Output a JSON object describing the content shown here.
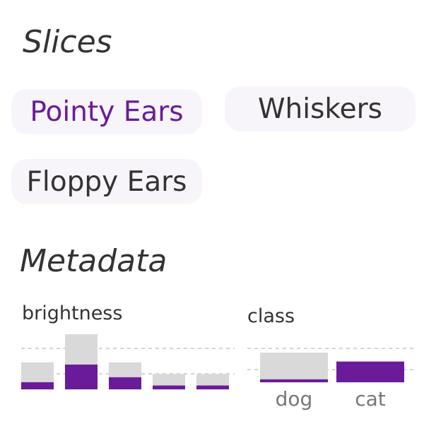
{
  "slices": {
    "title": "Slices",
    "chips": [
      {
        "label": "Pointy Ears",
        "selected": true
      },
      {
        "label": "Whiskers",
        "selected": false
      },
      {
        "label": "Floppy Ears",
        "selected": false
      }
    ]
  },
  "metadata": {
    "title": "Metadata"
  },
  "colors": {
    "accent": "#6a1b9a",
    "bar_total": "#d9d9d9",
    "chip_bg": "#f8f5fa",
    "gridline": "#d4d4d4"
  },
  "chart_data": [
    {
      "type": "bar",
      "label": "brightness",
      "xlabel": "",
      "ylabel": "",
      "ylim": [
        0,
        1
      ],
      "grid": true,
      "categories": [
        "",
        "",
        "",
        "",
        ""
      ],
      "series": [
        {
          "name": "",
          "values": [
            0.49,
            1.0,
            0.49,
            0.28,
            0.28
          ]
        },
        {
          "name": "",
          "values": [
            0.13,
            0.45,
            0.22,
            0.07,
            0.07
          ]
        }
      ]
    },
    {
      "type": "bar",
      "label": "class",
      "xlabel": "",
      "ylabel": "",
      "ylim": [
        0,
        1
      ],
      "grid": true,
      "categories": [
        "dog",
        "cat"
      ],
      "series": [
        {
          "name": "",
          "values": [
            1.0,
            0.0
          ]
        },
        {
          "name": "",
          "values": [
            0.1,
            0.7
          ]
        }
      ]
    }
  ]
}
